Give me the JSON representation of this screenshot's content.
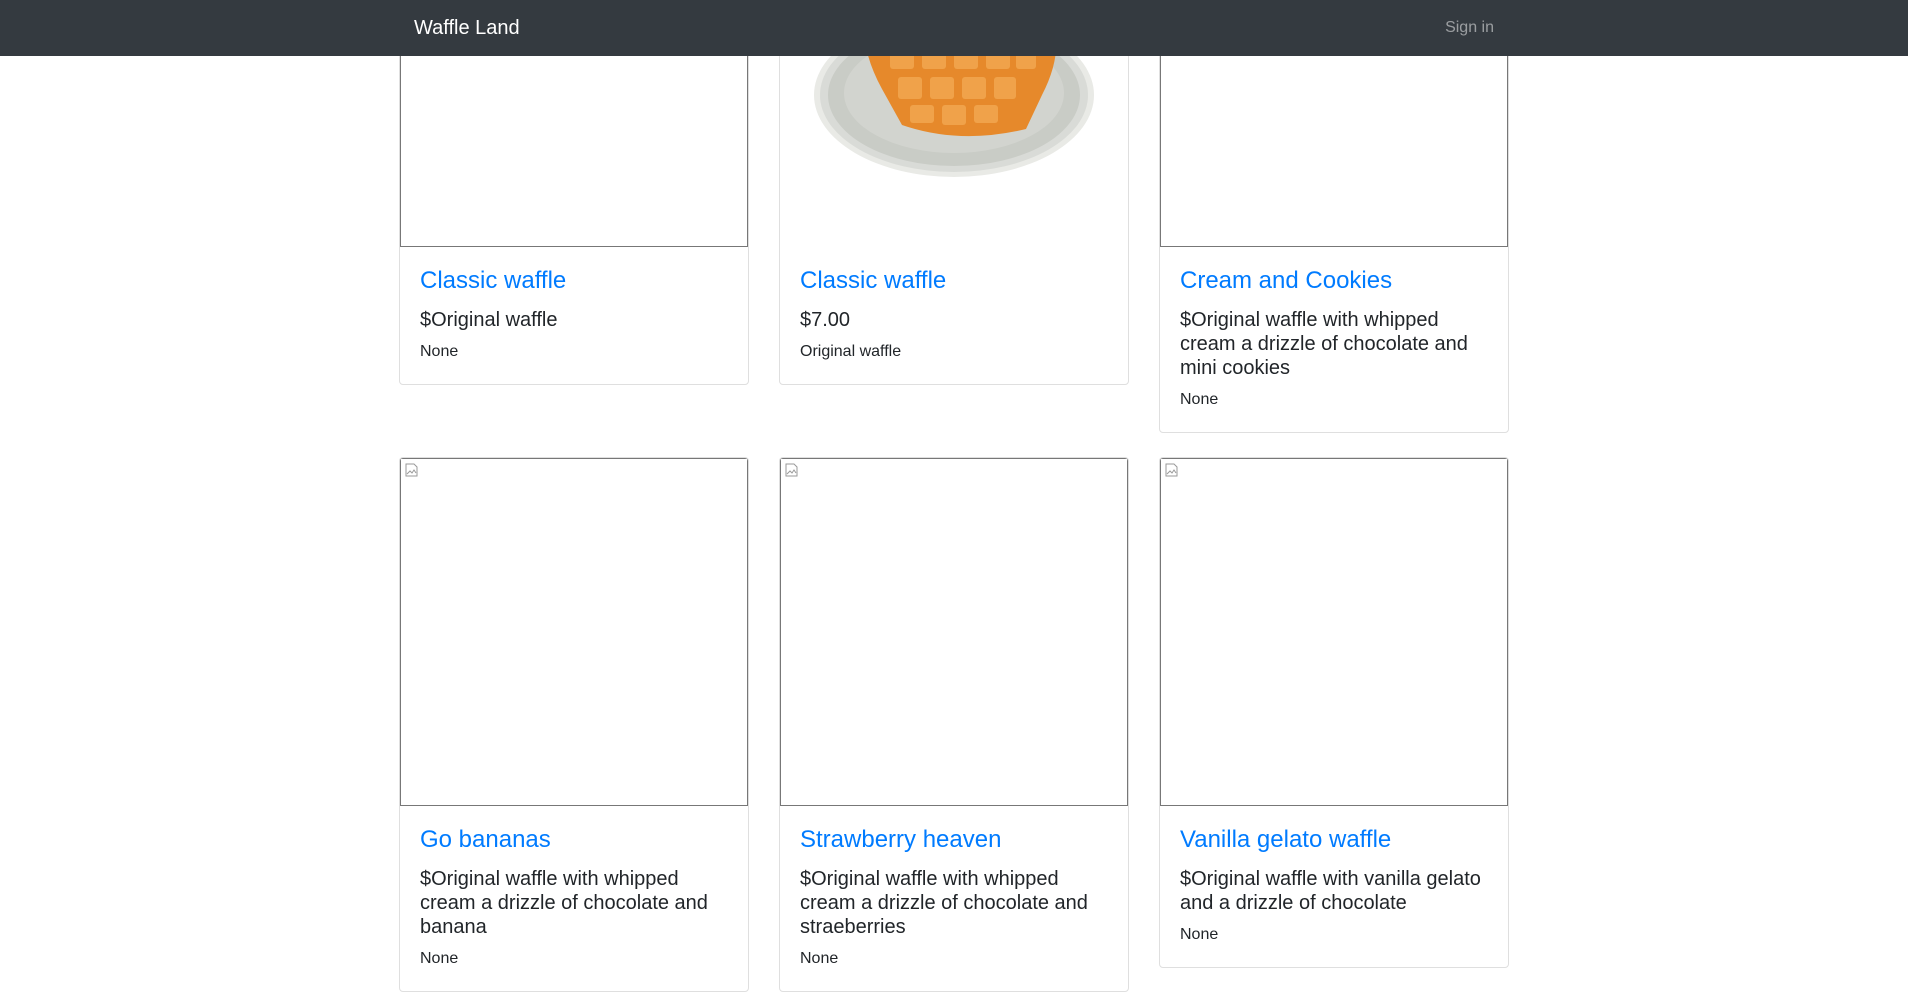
{
  "navbar": {
    "brand": "Waffle Land",
    "sign_in": "Sign in",
    "background": "#343a40"
  },
  "accent_color": "#007bff",
  "cards": [
    {
      "title": "Classic waffle",
      "price": "$Original waffle",
      "description": "None",
      "image": "broken"
    },
    {
      "title": "Classic waffle",
      "price": "$7.00",
      "description": "Original waffle",
      "image": "waffle-photo"
    },
    {
      "title": "Cream and Cookies",
      "price": "$Original waffle with whipped cream a drizzle of chocolate and mini cookies",
      "description": "None",
      "image": "broken"
    },
    {
      "title": "Go bananas",
      "price": "$Original waffle with whipped cream a drizzle of chocolate and banana",
      "description": "None",
      "image": "broken-icon"
    },
    {
      "title": "Strawberry heaven",
      "price": "$Original waffle with whipped cream a drizzle of chocolate and straeberries",
      "description": "None",
      "image": "broken-icon"
    },
    {
      "title": "Vanilla gelato waffle",
      "price": "$Original waffle with vanilla gelato and a drizzle of chocolate",
      "description": "None",
      "image": "broken-icon"
    }
  ]
}
